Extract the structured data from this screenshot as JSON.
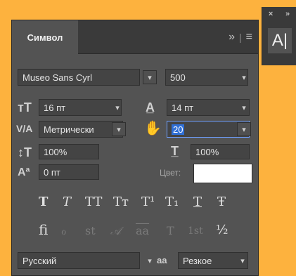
{
  "panel": {
    "title": "Символ",
    "menu_symbols": "»",
    "separator": "|",
    "menu_icon": "≡"
  },
  "toolbar": {
    "expand_symbol": "»",
    "close_symbol": "×",
    "type_tool_label": "A|"
  },
  "font": {
    "family": "Museo Sans Cyrl",
    "weight": "500"
  },
  "size": {
    "font_size": "16 пт",
    "leading": "14 пт"
  },
  "kerning": {
    "label": "V/A",
    "value": "Метрически",
    "tracking": "20"
  },
  "scale": {
    "vertical": "100%",
    "horizontal": "100%"
  },
  "baseline": {
    "shift": "0 пт",
    "color_label": "Цвет:"
  },
  "styles": {
    "buttons": [
      "T",
      "T",
      "TT",
      "Tт",
      "T¹",
      "T₁",
      "T",
      "Ŧ"
    ]
  },
  "opentype": {
    "buttons": [
      "ﬁ",
      "ℴ",
      "st",
      "𝒜",
      "aa",
      "T",
      "1st",
      "½"
    ]
  },
  "bottom": {
    "language": "Русский",
    "aa_label": "aa",
    "antialias": "Резкое"
  },
  "colors": {
    "background": "#fdb23e",
    "panel": "#535353",
    "highlight": "#2f6fd6"
  }
}
